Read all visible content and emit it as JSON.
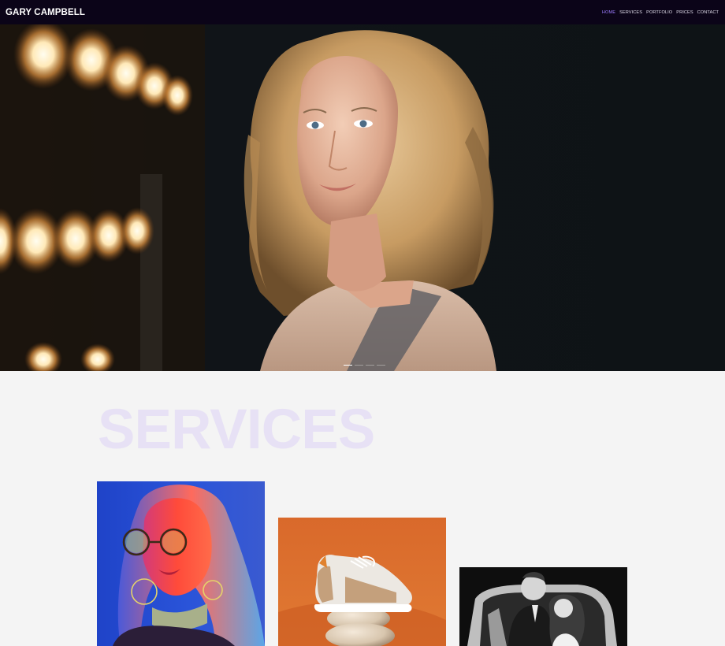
{
  "brand": "GARY CAMPBELL",
  "nav": [
    {
      "label": "HOME",
      "active": true
    },
    {
      "label": "SERVICES",
      "active": false
    },
    {
      "label": "PORTFOLIO",
      "active": false
    },
    {
      "label": "PRICES",
      "active": false
    },
    {
      "label": "CONTACT",
      "active": false
    }
  ],
  "hero": {
    "slides_total": 4,
    "current_slide": 1
  },
  "services": {
    "title": "SERVICES",
    "cards": [
      {
        "image": "portrait-neon-woman-photo"
      },
      {
        "image": "sneaker-product-photo"
      },
      {
        "image": "couple-bw-photo"
      }
    ]
  },
  "colors": {
    "topbar": "#0b0418",
    "accent": "#9d7dff",
    "page_bg": "#f4f4f4",
    "title": "#e7e1f5"
  }
}
